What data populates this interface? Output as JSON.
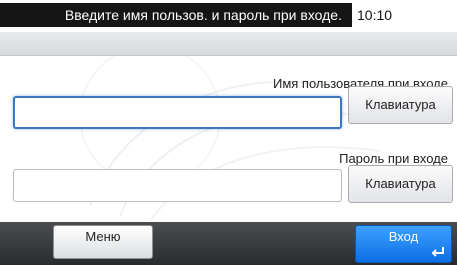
{
  "header": {
    "message": "Введите имя пользов. и пароль при входе.",
    "time": "10:10"
  },
  "form": {
    "username": {
      "label": "Имя пользователя при входе",
      "value": "",
      "keyboard_label": "Клавиатура"
    },
    "password": {
      "label": "Пароль при входе",
      "value": "",
      "keyboard_label": "Клавиатура"
    }
  },
  "footer": {
    "menu_label": "Меню",
    "login_label": "Вход"
  },
  "colors": {
    "accent": "#1a85f5",
    "title_bg": "#151515",
    "bottom_bar": "#3a3b3f"
  }
}
